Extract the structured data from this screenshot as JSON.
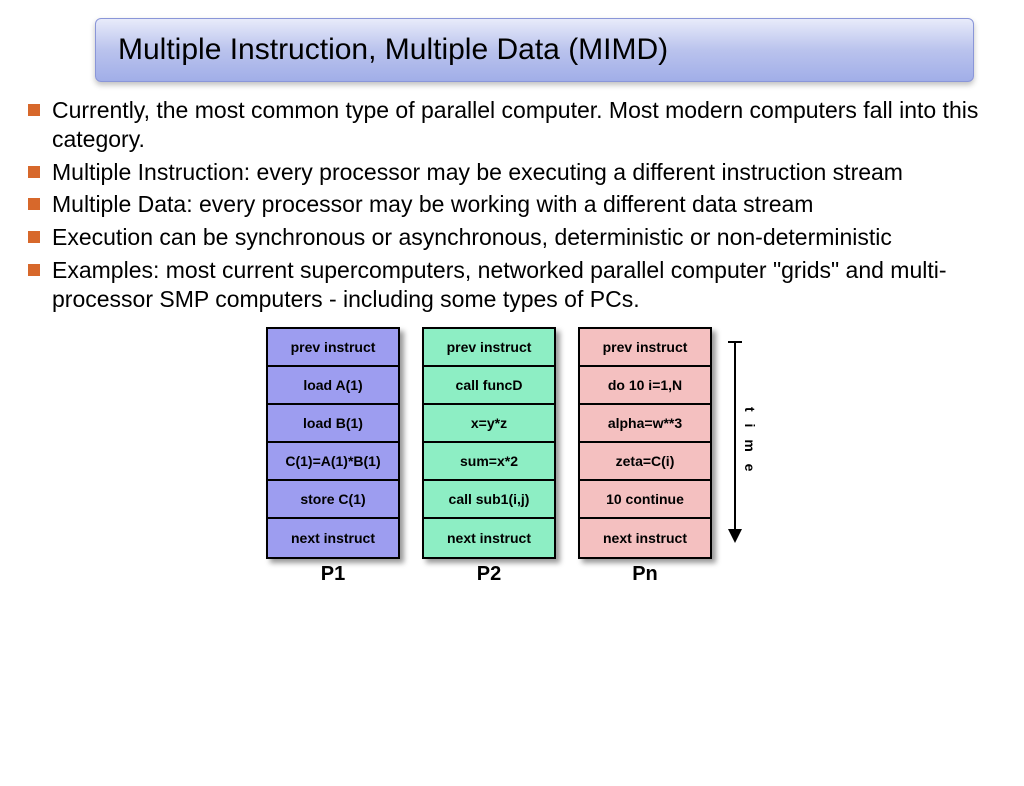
{
  "title": "Multiple Instruction, Multiple Data (MIMD)",
  "bullets": [
    "Currently, the most common type of parallel computer. Most modern computers fall into this category.",
    "Multiple Instruction: every processor may be executing a different instruction stream",
    "Multiple Data: every processor may be working with a different data stream",
    "Execution can be synchronous or asynchronous, deterministic or non-deterministic",
    "Examples: most current supercomputers, networked parallel computer \"grids\" and multi-processor SMP computers - including some types of PCs."
  ],
  "time_label": "t i m e",
  "processors": [
    {
      "label": "P1",
      "color": "c-purple",
      "cells": [
        "prev instruct",
        "load A(1)",
        "load B(1)",
        "C(1)=A(1)*B(1)",
        "store C(1)",
        "next instruct"
      ]
    },
    {
      "label": "P2",
      "color": "c-green",
      "cells": [
        "prev instruct",
        "call funcD",
        "x=y*z",
        "sum=x*2",
        "call sub1(i,j)",
        "next instruct"
      ]
    },
    {
      "label": "Pn",
      "color": "c-pink",
      "cells": [
        "prev instruct",
        "do 10 i=1,N",
        "alpha=w**3",
        "zeta=C(i)",
        "10 continue",
        "next instruct"
      ]
    }
  ]
}
